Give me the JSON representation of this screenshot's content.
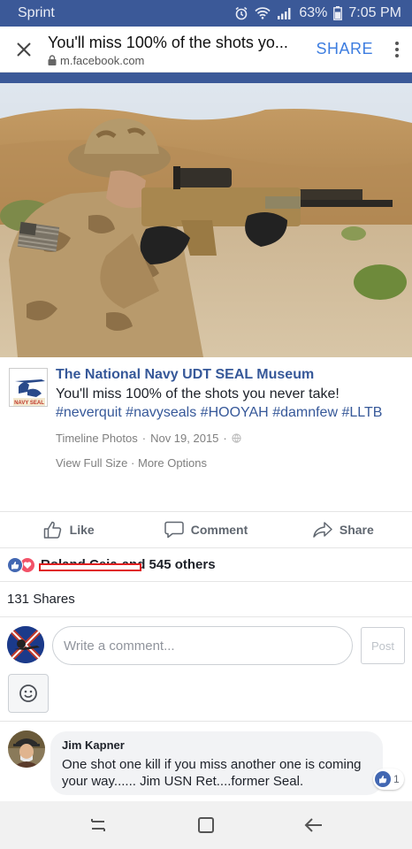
{
  "status_bar": {
    "carrier": "Sprint",
    "battery": "63%",
    "time": "7:05 PM"
  },
  "header": {
    "title": "You'll miss 100% of the shots yo...",
    "url": "m.facebook.com",
    "share_label": "SHARE"
  },
  "post": {
    "page_name": "The National Navy UDT SEAL Museum",
    "logo_text": "NAVY SEAL",
    "caption_text": "You'll miss 100% of the shots you never take! ",
    "hashtags": [
      "#neverquit",
      "#navyseals",
      "#HOOYAH",
      "#damnfew",
      "#LLTB"
    ],
    "album": "Timeline Photos",
    "date": "Nov 19, 2015",
    "view_full_size": "View Full Size",
    "more_options": "More Options"
  },
  "actions": {
    "like": "Like",
    "comment": "Comment",
    "share": "Share"
  },
  "reactions": {
    "names": "Roland Ceja",
    "others": "and 545 others"
  },
  "shares": "131 Shares",
  "composer": {
    "placeholder": "Write a comment...",
    "post_label": "Post"
  },
  "comment": {
    "author": "Jim Kapner",
    "text": "One shot one kill if you miss another one is coming your way...... Jim USN Ret....former Seal.",
    "likes": "1"
  },
  "colors": {
    "facebook_blue": "#3b5998",
    "link_blue": "#365899",
    "chrome_link": "#3d7de0",
    "redaction_red": "#e02020"
  }
}
